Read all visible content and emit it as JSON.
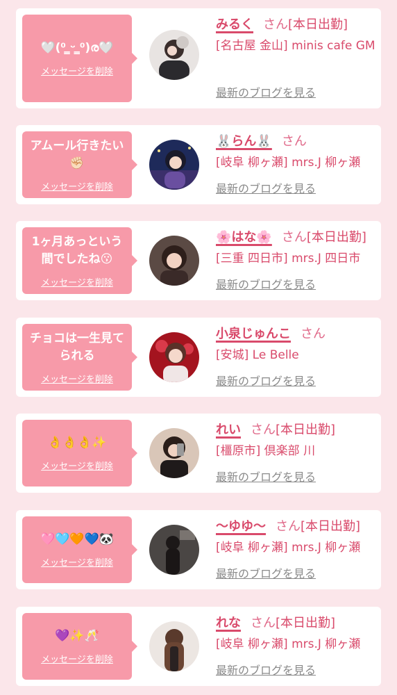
{
  "entries": [
    {
      "message": "🤍(⁰ ̳ᵕ ̳⁰)ര🤍",
      "delete_label": "メッセージを削除",
      "name": "みるく",
      "honorific": "さん",
      "status": "[本日出勤]",
      "shop": "[名古屋 金山] minis cafe GM",
      "blog_label": "最新のブログを見る",
      "avatar_icon": "person-photo-icon"
    },
    {
      "message": "アムール行きたい✊🏻",
      "delete_label": "メッセージを削除",
      "name": "🐰らん🐰",
      "honorific": "さん",
      "status": "",
      "shop": "[岐阜 柳ヶ瀬] mrs.J 柳ヶ瀬",
      "blog_label": "最新のブログを見る",
      "avatar_icon": "person-photo-icon"
    },
    {
      "message": "1ヶ月あっという間でしたね😗",
      "delete_label": "メッセージを削除",
      "name": "🌸はな🌸",
      "honorific": "さん",
      "status": "[本日出勤]",
      "shop": "[三重 四日市] mrs.J 四日市",
      "blog_label": "最新のブログを見る",
      "avatar_icon": "person-photo-icon"
    },
    {
      "message": "チョコは一生見てられる",
      "delete_label": "メッセージを削除",
      "name": "小泉じゅんこ",
      "honorific": "さん",
      "status": "",
      "shop": "[安城] Le Belle",
      "blog_label": "最新のブログを見る",
      "avatar_icon": "person-photo-icon"
    },
    {
      "message": "👌👌👌✨",
      "delete_label": "メッセージを削除",
      "name": "れい",
      "honorific": "さん",
      "status": "[本日出勤]",
      "shop": "[橿原市] 倶楽部 川",
      "blog_label": "最新のブログを見る",
      "avatar_icon": "person-photo-icon"
    },
    {
      "message": "🩷🩵🧡💙🐼",
      "delete_label": "メッセージを削除",
      "name": "〜ゆゆ〜",
      "honorific": "さん",
      "status": "[本日出勤]",
      "shop": "[岐阜 柳ヶ瀬] mrs.J 柳ヶ瀬",
      "blog_label": "最新のブログを見る",
      "avatar_icon": "person-photo-icon"
    },
    {
      "message": "💜✨🥂",
      "delete_label": "メッセージを削除",
      "name": "れな",
      "honorific": "さん",
      "status": "[本日出勤]",
      "shop": "[岐阜 柳ヶ瀬] mrs.J 柳ヶ瀬",
      "blog_label": "最新のブログを見る",
      "avatar_icon": "person-photo-icon"
    }
  ]
}
